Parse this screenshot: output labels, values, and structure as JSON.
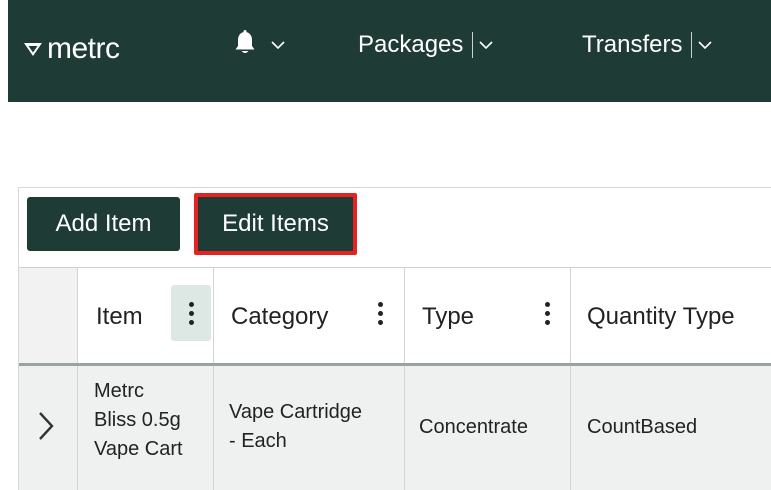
{
  "navbar": {
    "logo_text": "metrc",
    "logo_icon": "metrc-logo-icon",
    "bell_icon": "bell-icon",
    "items": [
      {
        "label": "Packages"
      },
      {
        "label": "Transfers"
      }
    ],
    "background": "#1f3b35"
  },
  "toolbar": {
    "add_label": "Add Item",
    "edit_label": "Edit Items",
    "highlight_color": "#e52421"
  },
  "table": {
    "columns": [
      "Item",
      "Category",
      "Type",
      "Quantity Type"
    ],
    "rows": [
      {
        "item": [
          "Metrc",
          "Bliss 0.5g",
          "Vape Cart"
        ],
        "category": [
          "Vape Cartridge",
          "- Each"
        ],
        "type": "Concentrate",
        "quantity_type": "CountBased"
      }
    ]
  }
}
